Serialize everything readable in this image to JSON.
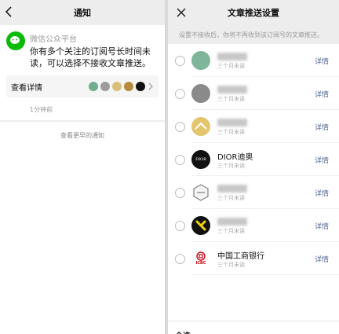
{
  "left": {
    "title": "通知",
    "card": {
      "source": "微信公众平台",
      "message": "你有多个关注的订阅号长时间未读，可以选择不接收文章推送。",
      "detail_label": "查看详情",
      "time": "1分钟前"
    },
    "more": "查看更早的通知"
  },
  "right": {
    "title": "文章推送设置",
    "notice": "设置不接收后，你将不再收到该订阅号的文章推送。",
    "rows": [
      {
        "name": "",
        "sub": "三个月未读",
        "detail": "详情"
      },
      {
        "name": "",
        "sub": "三个月未读",
        "detail": "详情"
      },
      {
        "name": "",
        "sub": "三个月未读",
        "detail": "详情"
      },
      {
        "name": "DIOR迪奥",
        "sub": "三个月未读",
        "detail": "详情"
      },
      {
        "name": "",
        "sub": "三个月未读",
        "detail": "详情"
      },
      {
        "name": "",
        "sub": "三个月未读",
        "detail": "详情"
      },
      {
        "name": "中国工商银行",
        "sub": "三个月未读",
        "detail": "详情"
      }
    ],
    "footer": "全选"
  },
  "logos": {
    "dior_text": "DIOR",
    "icbc_text": "ICBC"
  },
  "colors": {
    "wechat_green": "#09bb07",
    "link_blue": "#576b95"
  }
}
